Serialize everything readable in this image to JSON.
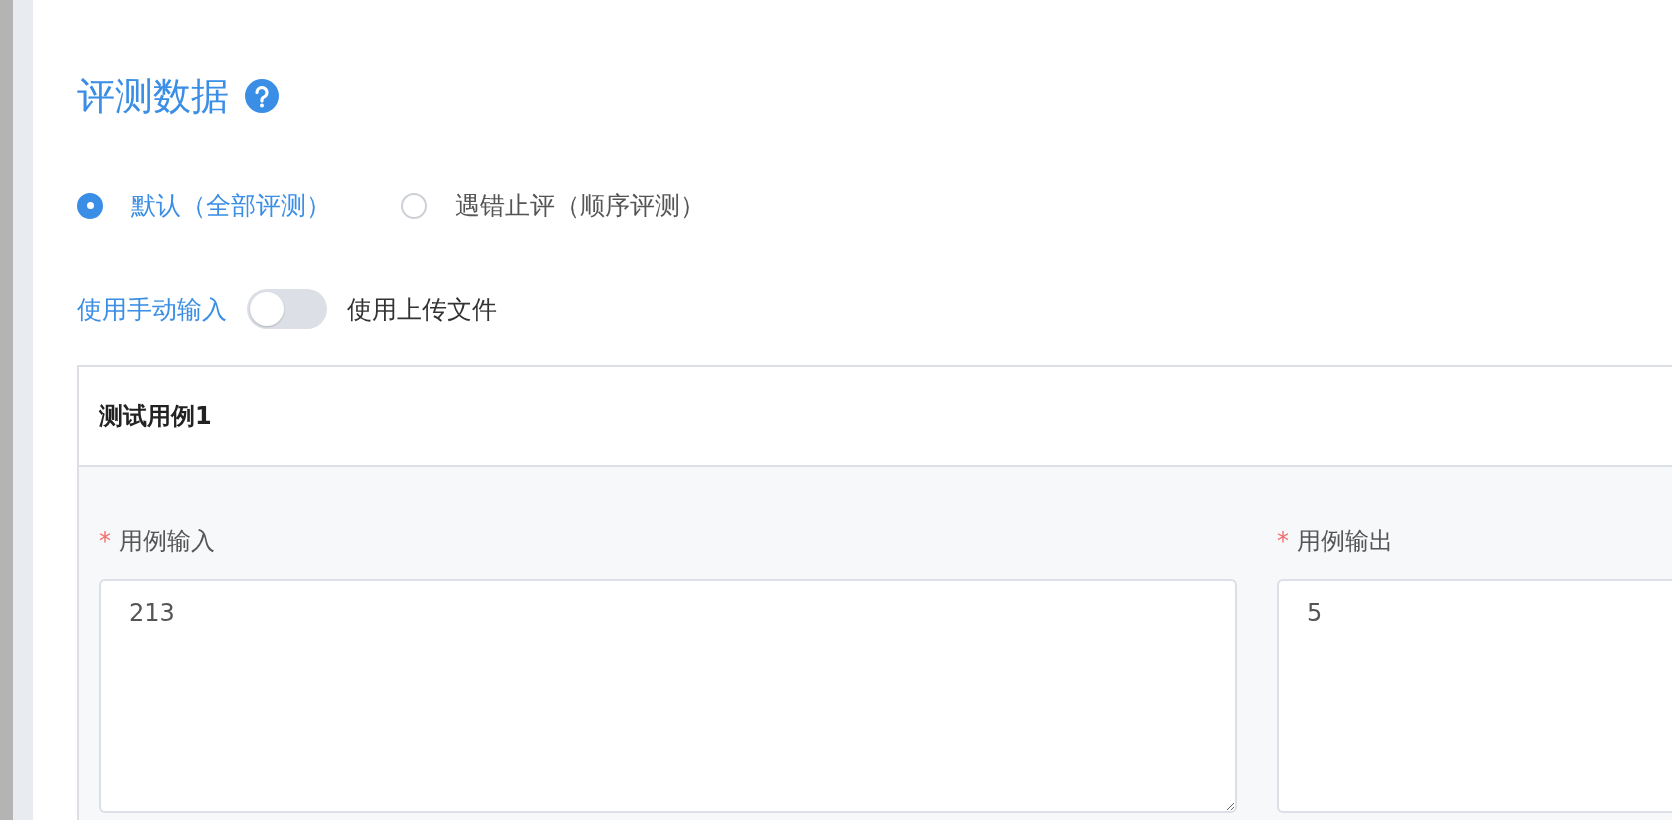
{
  "section": {
    "title": "评测数据"
  },
  "judge_modes": [
    {
      "label": "默认（全部评测）",
      "selected": true
    },
    {
      "label": "遇错止评（顺序评测）",
      "selected": false
    }
  ],
  "input_switch": {
    "left_label": "使用手动输入",
    "right_label": "使用上传文件",
    "on": false
  },
  "test_case": {
    "title": "测试用例1",
    "fields": [
      {
        "required_mark": "*",
        "label": "用例输入",
        "value": "213"
      },
      {
        "required_mark": "*",
        "label": "用例输出",
        "value": "5"
      }
    ]
  }
}
